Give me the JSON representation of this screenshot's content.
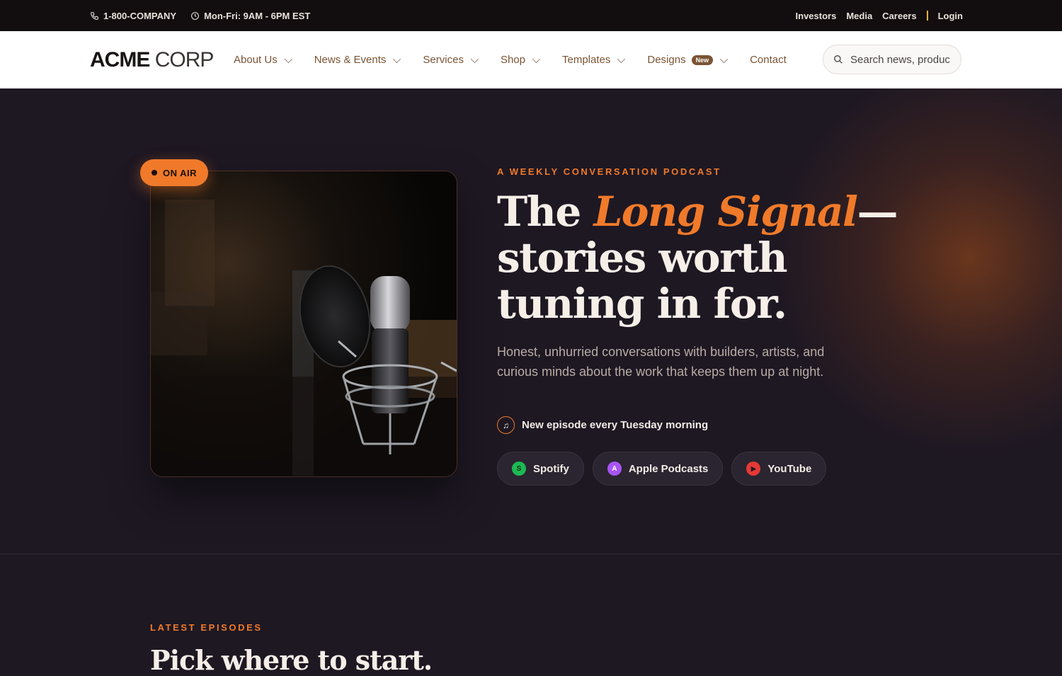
{
  "topbar": {
    "phone": "1-800-COMPANY",
    "hours": "Mon-Fri: 9AM - 6PM EST",
    "links": [
      "Investors",
      "Media",
      "Careers"
    ],
    "login": "Login"
  },
  "header": {
    "logo_bold": "ACME",
    "logo_light": "CORP",
    "nav": [
      {
        "label": "About Us"
      },
      {
        "label": "News & Events"
      },
      {
        "label": "Services"
      },
      {
        "label": "Shop"
      },
      {
        "label": "Templates"
      },
      {
        "label": "Designs",
        "badge": "New"
      },
      {
        "label": "Contact"
      }
    ],
    "search_placeholder": "Search news, products..."
  },
  "hero": {
    "on_air": "ON AIR",
    "eyebrow": "A WEEKLY CONVERSATION PODCAST",
    "title_pre": "The ",
    "title_accent": "Long Signal",
    "title_post": "— stories worth tuning in for.",
    "description": "Honest, unhurried conversations with builders, artists, and curious minds about the work that keeps them up at night.",
    "cadence": "New episode every Tuesday morning",
    "platforms": [
      {
        "label": "Spotify",
        "icon": "spotify-icon",
        "letter": "S",
        "color": "#1db954"
      },
      {
        "label": "Apple Podcasts",
        "icon": "apple-podcasts-icon",
        "letter": "A",
        "color": "#a855f7"
      },
      {
        "label": "YouTube",
        "icon": "youtube-icon",
        "letter": "▶",
        "color": "#e53935"
      }
    ]
  },
  "latest": {
    "eyebrow": "LATEST EPISODES",
    "title": "Pick where to start."
  },
  "colors": {
    "accent": "#f07a2a",
    "background": "#1e1823",
    "nav_text": "#7a5434"
  }
}
